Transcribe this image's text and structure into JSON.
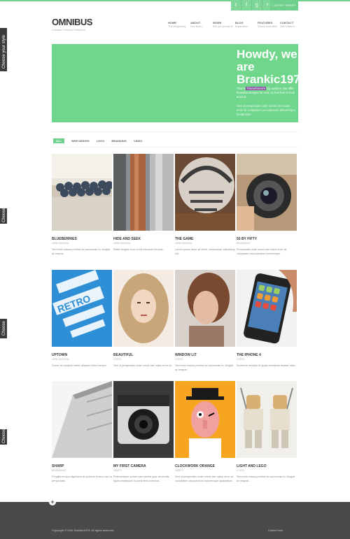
{
  "topbar": {
    "social": [
      "t",
      "f",
      "g",
      "r"
    ],
    "latest": "LATEST TWEET"
  },
  "header": {
    "logo": "OMNIBUS",
    "tagline": "Creative Portfolio Premium"
  },
  "nav": [
    {
      "title": "HOME",
      "sub": "The beginning"
    },
    {
      "title": "ABOUT",
      "sub": "Our team"
    },
    {
      "title": "WORK",
      "sub": "We are proud of"
    },
    {
      "title": "BLOG",
      "sub": "Inspiration"
    },
    {
      "title": "FEATURES",
      "sub": "Some cool stuff"
    },
    {
      "title": "CONTACT",
      "sub": "Get in touch"
    }
  ],
  "chooser": [
    "Choose your style",
    "Choose",
    "Choose",
    "Choose"
  ],
  "hero": {
    "title": "Howdy, we are Brankic1979",
    "p1_pre": "This is",
    "p1_badge": "Themeforest's",
    "p1_post": "top authors. We offer beautiful designs for web, so feel free to look around.",
    "p2": "Sed ut perspiciatis unde omnis iste natus error sit voluptatem accusantium doloremque laudantium."
  },
  "filters": [
    "ALL",
    "WEB DESIGN",
    "LOGO",
    "BRANDING",
    "VIDEO"
  ],
  "items": [
    {
      "title": "BLUEBERRIES",
      "cat": "WEB DESIGN",
      "desc": "Sed enim massa pretium ac accumsan in, feugiat ac mauris."
    },
    {
      "title": "HIDE AND SEEK",
      "cat": "WEB DESIGN",
      "desc": "Etiam feugiat nunc id elit interdum tempus."
    },
    {
      "title": "THE GAME",
      "cat": "WEB DESIGN",
      "desc": "Lorem ipsum dolor sit amet, consectetur adipiscing elit."
    },
    {
      "title": "50 BY FIFTY",
      "cat": "BRANDING",
      "desc": "Perspiciatis unde omnis iste natus error sit voluptatem accusantium doloremque."
    },
    {
      "title": "UPTOWN",
      "cat": "WEB DESIGN",
      "desc": "Donec at volutpat metus aliquam tellus tempor."
    },
    {
      "title": "BEAUTIFUL",
      "cat": "LOGO",
      "desc": "Sed ut perspiciatis unde omnis iste natus error sit."
    },
    {
      "title": "WINDOW LIT",
      "cat": "LOGO",
      "desc": "Sed enim massa pretium ac accumsan in, feugiat ac magna."
    },
    {
      "title": "THE IPHONE 4",
      "cat": "LOGO",
      "desc": "Inventore veritatis et quasi architecto beatae vitae."
    },
    {
      "title": "SHARP",
      "cat": "BRANDING",
      "desc": "Fringilla tempor dignissim ac pretium et arcu sed ut perspiciatis."
    },
    {
      "title": "MY FIRST CAMERA",
      "cat": "VIDEO",
      "desc": "Pellentesque ornare nam lacinia quis venenatis ligula vestibulum id porta felis euismod."
    },
    {
      "title": "CLOCKWORK ORANGE",
      "cat": "VIDEO",
      "desc": "Sed ut perspiciatis unde omnis iste natus error sit voluptatem accusantium doloremque laudantium."
    },
    {
      "title": "LIGHT AND LEGO",
      "cat": "LOGO",
      "desc": "Sed enim massa pretium ac accumsan in, feugiat ac magna."
    }
  ],
  "footer": {
    "copyright": "Copyright © 2011 Brankic1979. All rights reserved.",
    "collect": "Collect from"
  }
}
